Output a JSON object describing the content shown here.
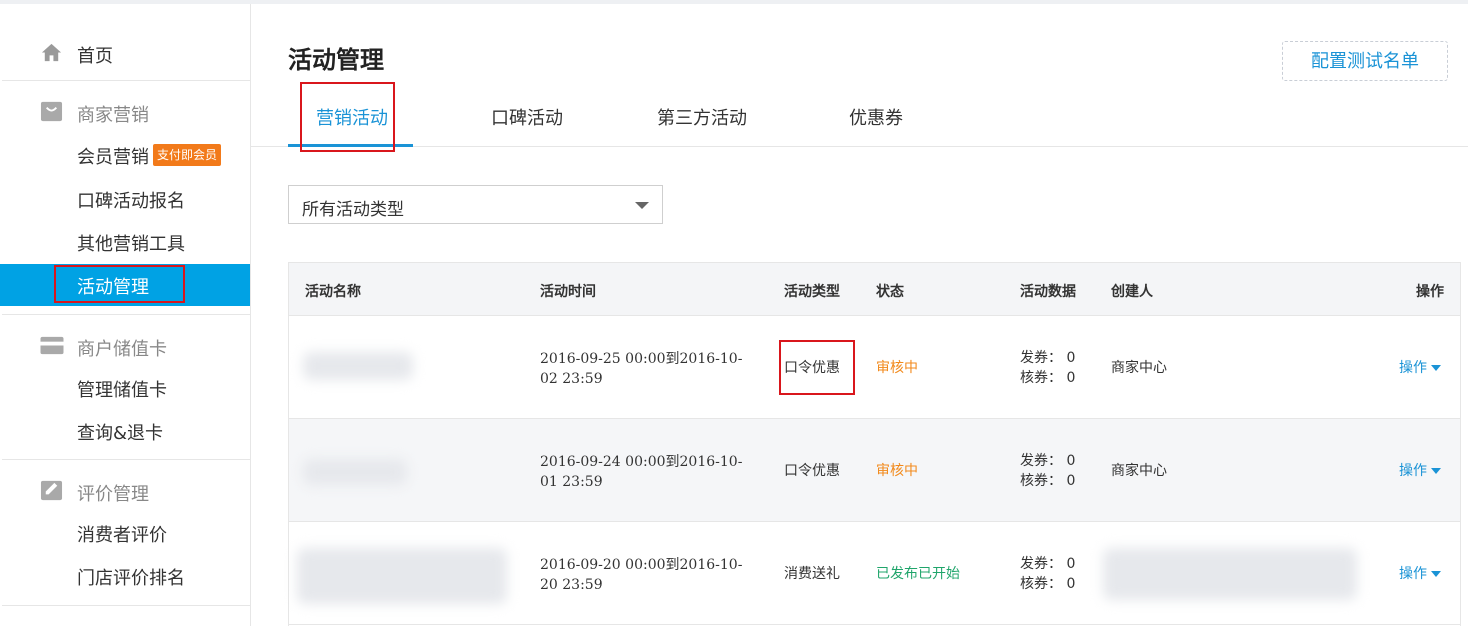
{
  "sidebar": {
    "home": {
      "label": "首页",
      "icon": "home-icon"
    },
    "sections": [
      {
        "title": "商家营销",
        "icon": "marketing-icon",
        "items": [
          {
            "label": "会员营销",
            "badge": "支付即会员"
          },
          {
            "label": "口碑活动报名"
          },
          {
            "label": "其他营销工具"
          },
          {
            "label": "活动管理",
            "active": true
          }
        ]
      },
      {
        "title": "商户储值卡",
        "icon": "card-icon",
        "items": [
          {
            "label": "管理储值卡"
          },
          {
            "label": "查询&退卡"
          }
        ]
      },
      {
        "title": "评价管理",
        "icon": "review-icon",
        "items": [
          {
            "label": "消费者评价"
          },
          {
            "label": "门店评价排名"
          }
        ]
      }
    ]
  },
  "main": {
    "title": "活动管理",
    "config_button": "配置测试名单",
    "tabs": [
      {
        "label": "营销活动",
        "active": true
      },
      {
        "label": "口碑活动"
      },
      {
        "label": "第三方活动"
      },
      {
        "label": "优惠券"
      }
    ],
    "filter": {
      "selected": "所有活动类型"
    },
    "table": {
      "headers": [
        "活动名称",
        "活动时间",
        "活动类型",
        "状态",
        "活动数据",
        "创建人",
        "操作"
      ],
      "rows": [
        {
          "time": "2016-09-25 00:00到2016-10-02 23:59",
          "type": "口令优惠",
          "status": "审核中",
          "status_color": "#f28a1c",
          "issued": "发券： 0",
          "redeemed": "核券： 0",
          "creator": "商家中心",
          "action": "操作"
        },
        {
          "time": "2016-09-24 00:00到2016-10-01 23:59",
          "type": "口令优惠",
          "status": "审核中",
          "status_color": "#f28a1c",
          "issued": "发券： 0",
          "redeemed": "核券： 0",
          "creator": "商家中心",
          "action": "操作"
        },
        {
          "time": "2016-09-20 00:00到2016-10-20 23:59",
          "type": "消费送礼",
          "status": "已发布已开始",
          "status_color": "#20a56b",
          "issued": "发券： 0",
          "redeemed": "核券： 0",
          "creator": "",
          "action": "操作"
        }
      ]
    }
  },
  "colors": {
    "accent": "#00a2e4",
    "link": "#1a93d6",
    "badge": "#f27a1a",
    "highlight": "#d9161c"
  }
}
